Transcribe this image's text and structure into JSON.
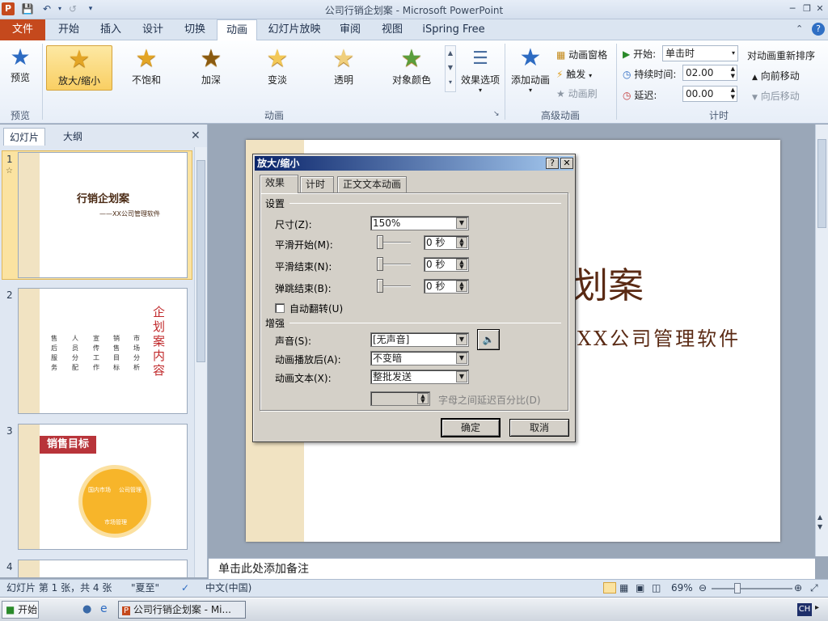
{
  "window": {
    "title": "公司行销企划案 - Microsoft PowerPoint"
  },
  "tabs": {
    "file": "文件",
    "items": [
      "开始",
      "插入",
      "设计",
      "切换",
      "动画",
      "幻灯片放映",
      "审阅",
      "视图",
      "iSpring Free"
    ]
  },
  "ribbon": {
    "preview": {
      "button": "预览",
      "group": "预览"
    },
    "animation": {
      "group": "动画",
      "effects": [
        "放大/缩小",
        "不饱和",
        "加深",
        "变淡",
        "透明",
        "对象颜色"
      ],
      "options": "效果选项"
    },
    "advanced": {
      "group": "高级动画",
      "add": "添加动画",
      "pane": "动画窗格",
      "trigger": "触发",
      "painter": "动画刷"
    },
    "timing": {
      "group": "计时",
      "start_label": "开始:",
      "start_value": "单击时",
      "duration_label": "持续时间:",
      "duration_value": "02.00",
      "delay_label": "延迟:",
      "delay_value": "00.00",
      "reorder": "对动画重新排序",
      "move_earlier": "向前移动",
      "move_later": "向后移动"
    }
  },
  "left_pane": {
    "tab_slides": "幻灯片",
    "tab_outline": "大纲",
    "slides": [
      {
        "num": "1",
        "title": "行销企划案",
        "subtitle": "——XX公司管理软件"
      },
      {
        "num": "2",
        "title": "企划案内容",
        "columns": [
          "售后服务",
          "人员分配",
          "宣传工作",
          "销售目标",
          "市场分析"
        ]
      },
      {
        "num": "3",
        "title": "销售目标",
        "segments": [
          "国内市场",
          "公司管理",
          "市场管理"
        ]
      },
      {
        "num": "4"
      }
    ]
  },
  "slide": {
    "title_fragment": "划案",
    "subtitle_fragment": "XX公司管理软件"
  },
  "notes": {
    "placeholder": "单击此处添加备注"
  },
  "statusbar": {
    "slide_info": "幻灯片 第 1 张，共 4 张",
    "theme": "\"夏至\"",
    "language": "中文(中国)",
    "zoom": "69%"
  },
  "taskbar": {
    "start": "开始",
    "item": "公司行销企划案 - Mi...",
    "ime": "CH"
  },
  "dialog": {
    "title": "放大/缩小",
    "tabs": [
      "效果",
      "计时",
      "正文文本动画"
    ],
    "settings_label": "设置",
    "size_label": "尺寸(Z):",
    "size_value": "150%",
    "smooth_start_label": "平滑开始(M):",
    "smooth_start_value": "0 秒",
    "smooth_end_label": "平滑结束(N):",
    "smooth_end_value": "0 秒",
    "bounce_end_label": "弹跳结束(B):",
    "bounce_end_value": "0 秒",
    "auto_reverse_label": "自动翻转(U)",
    "enhance_label": "增强",
    "sound_label": "声音(S):",
    "sound_value": "[无声音]",
    "after_label": "动画播放后(A):",
    "after_value": "不变暗",
    "text_label": "动画文本(X):",
    "text_value": "整批发送",
    "delay_pct_label": "字母之间延迟百分比(D)",
    "ok": "确定",
    "cancel": "取消"
  }
}
